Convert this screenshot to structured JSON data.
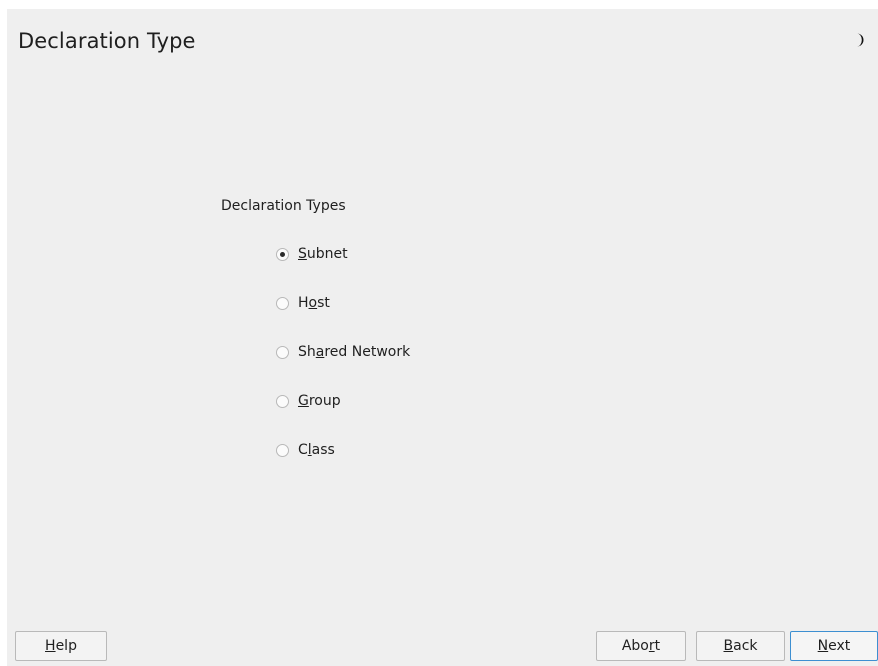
{
  "header": {
    "title": "Declaration Type"
  },
  "form": {
    "group_label": "Declaration Types",
    "selected": "Subnet",
    "options": [
      {
        "pre": "",
        "key": "S",
        "post": "ubnet",
        "checked": true
      },
      {
        "pre": "H",
        "key": "o",
        "post": "st",
        "checked": false
      },
      {
        "pre": "Sh",
        "key": "a",
        "post": "red Network",
        "checked": false
      },
      {
        "pre": "",
        "key": "G",
        "post": "roup",
        "checked": false
      },
      {
        "pre": "C",
        "key": "l",
        "post": "ass",
        "checked": false
      }
    ]
  },
  "buttons": {
    "help": {
      "pre": "",
      "key": "H",
      "post": "elp"
    },
    "abort": {
      "pre": "Abo",
      "key": "r",
      "post": "t"
    },
    "back": {
      "pre": "",
      "key": "B",
      "post": "ack"
    },
    "next": {
      "pre": "",
      "key": "N",
      "post": "ext"
    }
  },
  "icons": {
    "theme": "moon-icon"
  },
  "colors": {
    "background": "#efefef",
    "default_button_border": "#3d8fd1"
  }
}
